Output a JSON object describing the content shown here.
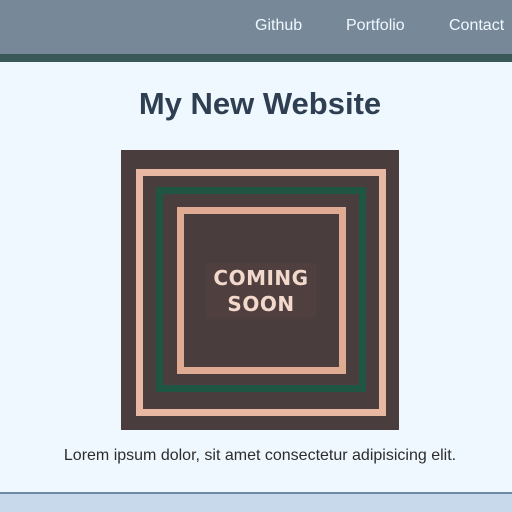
{
  "nav": {
    "items": [
      {
        "label": "Github"
      },
      {
        "label": "Portfolio"
      },
      {
        "label": "Contact"
      }
    ]
  },
  "main": {
    "title": "My New Website",
    "hero": {
      "badge_line1": "COMING",
      "badge_line2": "SOON"
    },
    "description": "Lorem ipsum dolor, sit amet consectetur adipisicing elit."
  },
  "colors": {
    "header_bg": "#778899",
    "header_border": "#2f4f4f",
    "page_bg": "#f0f8ff",
    "title_text": "#2f3f52",
    "hero_bg": "#4a3d3d",
    "frame_peach": "#e8b8a3",
    "frame_green": "#1f5543",
    "footer_bg": "#c7d9ea"
  }
}
